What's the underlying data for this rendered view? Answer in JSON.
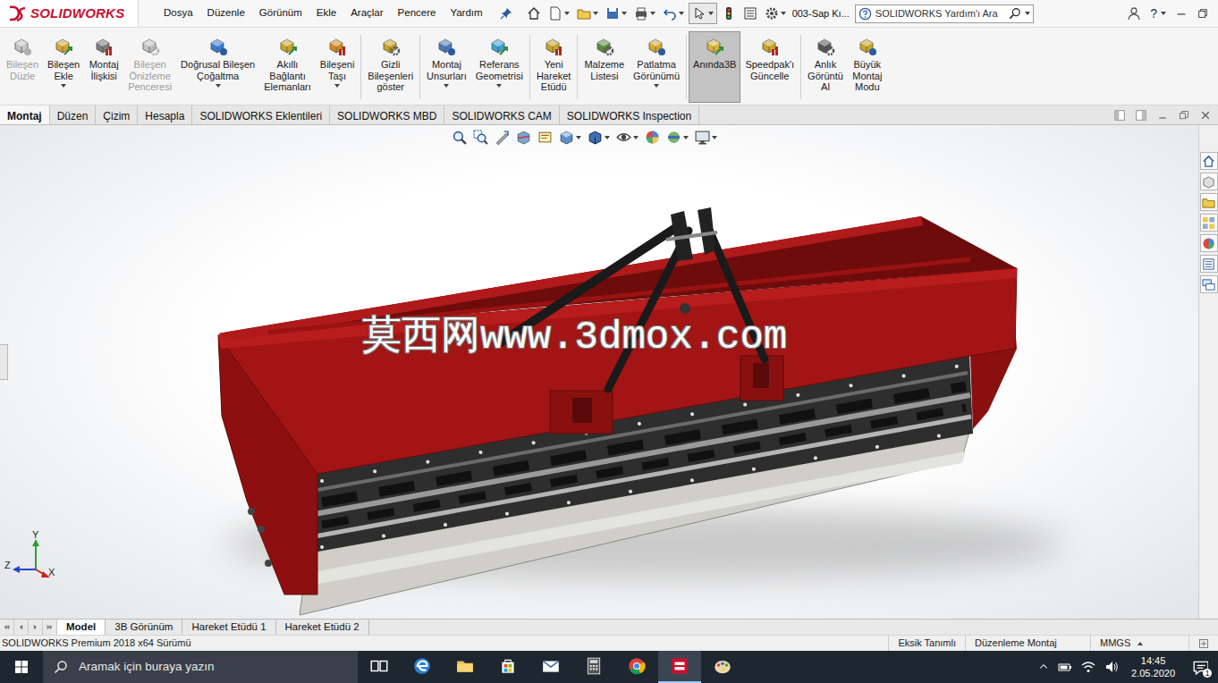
{
  "app": {
    "logo": "SOLIDWORKS",
    "document_title": "003-Sap Kı...",
    "help": "?"
  },
  "menu": [
    "Dosya",
    "Düzenle",
    "Görünüm",
    "Ekle",
    "Araçlar",
    "Pencere",
    "Yardım"
  ],
  "search": {
    "placeholder": "SOLIDWORKS Yardım'ı Ara"
  },
  "ribbon": {
    "items": [
      {
        "lines": [
          "Bileşen",
          "Düzle"
        ],
        "disabled": true,
        "selected": false,
        "dropdown": false
      },
      {
        "lines": [
          "Bileşen",
          "Ekle"
        ],
        "disabled": false,
        "selected": false,
        "dropdown": true
      },
      {
        "lines": [
          "Montaj",
          "İlişkisi"
        ],
        "disabled": false,
        "selected": false,
        "dropdown": false
      },
      {
        "lines": [
          "Bileşen",
          "Önizleme",
          "Penceresi"
        ],
        "disabled": true,
        "selected": false,
        "dropdown": false
      },
      {
        "lines": [
          "Doğrusal Bileşen",
          "Çoğaltma"
        ],
        "disabled": false,
        "selected": false,
        "dropdown": true
      },
      {
        "lines": [
          "Akıllı",
          "Bağlantı",
          "Elemanları"
        ],
        "disabled": false,
        "selected": false,
        "dropdown": false
      },
      {
        "lines": [
          "Bileşeni",
          "Taşı"
        ],
        "disabled": false,
        "selected": false,
        "dropdown": true
      },
      {
        "lines": [
          "Gizli",
          "Bileşenleri",
          "göster"
        ],
        "disabled": false,
        "selected": false,
        "dropdown": false
      },
      {
        "lines": [
          "Montaj",
          "Unsurları"
        ],
        "disabled": false,
        "selected": false,
        "dropdown": true
      },
      {
        "lines": [
          "Referans",
          "Geometrisi"
        ],
        "disabled": false,
        "selected": false,
        "dropdown": true
      },
      {
        "lines": [
          "Yeni",
          "Hareket",
          "Etüdü"
        ],
        "disabled": false,
        "selected": false,
        "dropdown": false
      },
      {
        "lines": [
          "Malzeme",
          "Listesi"
        ],
        "disabled": false,
        "selected": false,
        "dropdown": false
      },
      {
        "lines": [
          "Patlatma",
          "Görünümü"
        ],
        "disabled": false,
        "selected": false,
        "dropdown": true
      },
      {
        "lines": [
          "Anında3B"
        ],
        "disabled": false,
        "selected": true,
        "dropdown": false
      },
      {
        "lines": [
          "Speedpak'ı",
          "Güncelle"
        ],
        "disabled": false,
        "selected": false,
        "dropdown": false
      },
      {
        "lines": [
          "Anlık",
          "Görüntü",
          "Al"
        ],
        "disabled": false,
        "selected": false,
        "dropdown": false
      },
      {
        "lines": [
          "Büyük",
          "Montaj",
          "Modu"
        ],
        "disabled": false,
        "selected": false,
        "dropdown": false
      }
    ]
  },
  "command_tabs": [
    {
      "label": "Montaj",
      "selected": true
    },
    {
      "label": "Düzen",
      "selected": false
    },
    {
      "label": "Çizim",
      "selected": false
    },
    {
      "label": "Hesapla",
      "selected": false
    },
    {
      "label": "SOLIDWORKS Eklentileri",
      "selected": false
    },
    {
      "label": "SOLIDWORKS MBD",
      "selected": false
    },
    {
      "label": "SOLIDWORKS CAM",
      "selected": false
    },
    {
      "label": "SOLIDWORKS Inspection",
      "selected": false
    }
  ],
  "viewport": {
    "watermark": "莫西网www.3dmox.com",
    "triad": {
      "y": "Y",
      "z": "Z",
      "x": "X"
    }
  },
  "model_tabs": [
    {
      "label": "Model",
      "selected": true
    },
    {
      "label": "3B Görünüm",
      "selected": false
    },
    {
      "label": "Hareket Etüdü 1",
      "selected": false
    },
    {
      "label": "Hareket Etüdü 2",
      "selected": false
    }
  ],
  "status_bar": {
    "version": "SOLIDWORKS Premium 2018 x64 Sürümü",
    "definition": "Eksik Tanımlı",
    "mode": "Düzenleme Montaj",
    "units": "MMGS"
  },
  "taskbar": {
    "search_placeholder": "Aramak için buraya yazın",
    "apps": [
      {
        "kind": "taskview",
        "selected": false
      },
      {
        "kind": "edge",
        "selected": false
      },
      {
        "kind": "explorer",
        "selected": false
      },
      {
        "kind": "store",
        "selected": false
      },
      {
        "kind": "mail",
        "selected": false
      },
      {
        "kind": "calculator",
        "selected": false
      },
      {
        "kind": "chrome",
        "selected": false
      },
      {
        "kind": "solidworks",
        "selected": true
      },
      {
        "kind": "paint",
        "selected": false
      }
    ],
    "time": "14:45",
    "date": "2.05.2020",
    "notifications": "1"
  }
}
